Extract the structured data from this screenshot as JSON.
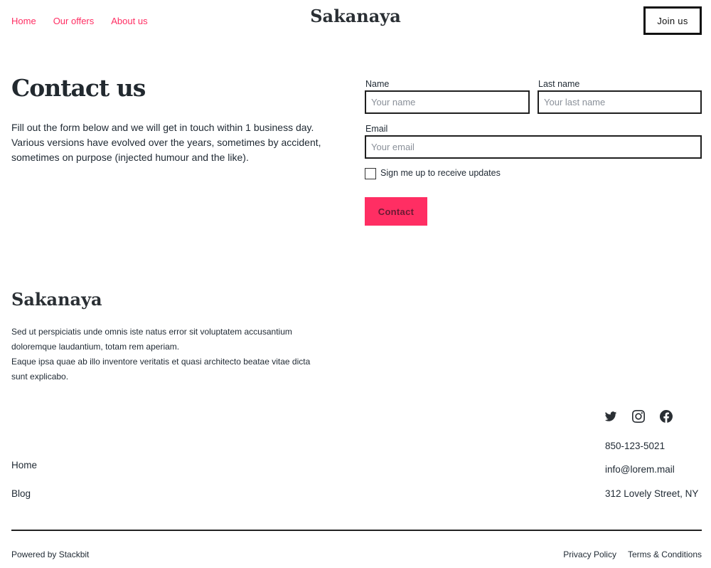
{
  "header": {
    "nav": [
      "Home",
      "Our offers",
      "About us"
    ],
    "brand": "Sakanaya",
    "join_label": "Join us"
  },
  "hero": {
    "title": "Contact us",
    "text": "Fill out the form below and we will get in touch within 1 business day. Various versions have evolved over the years, sometimes by accident, sometimes on purpose (injected humour and the like)."
  },
  "form": {
    "name_label": "Name",
    "name_placeholder": "Your name",
    "last_name_label": "Last name",
    "last_name_placeholder": "Your last name",
    "email_label": "Email",
    "email_placeholder": "Your email",
    "updates_label": "Sign me up to receive updates",
    "updates_checked": false,
    "submit_label": "Contact"
  },
  "footer": {
    "brand": "Sakanaya",
    "text_1": "Sed ut perspiciatis unde omnis iste natus error sit voluptatem accusantium doloremque laudantium, totam rem aperiam.",
    "text_2": "Eaque ipsa quae ab illo inventore veritatis et quasi architecto beatae vitae dicta sunt explicabo.",
    "social_icons": [
      "twitter-icon",
      "instagram-icon",
      "facebook-icon"
    ],
    "links": [
      "Home",
      "Blog"
    ],
    "phone": "850-123-5021",
    "email": "info@lorem.mail",
    "address": "312 Lovely Street, NY",
    "powered": "Powered by Stackbit",
    "legal": [
      "Privacy Policy",
      "Terms & Conditions"
    ]
  },
  "colors": {
    "accent": "#ff2e63",
    "text": "#1f2933",
    "border": "#1f1f1f"
  }
}
